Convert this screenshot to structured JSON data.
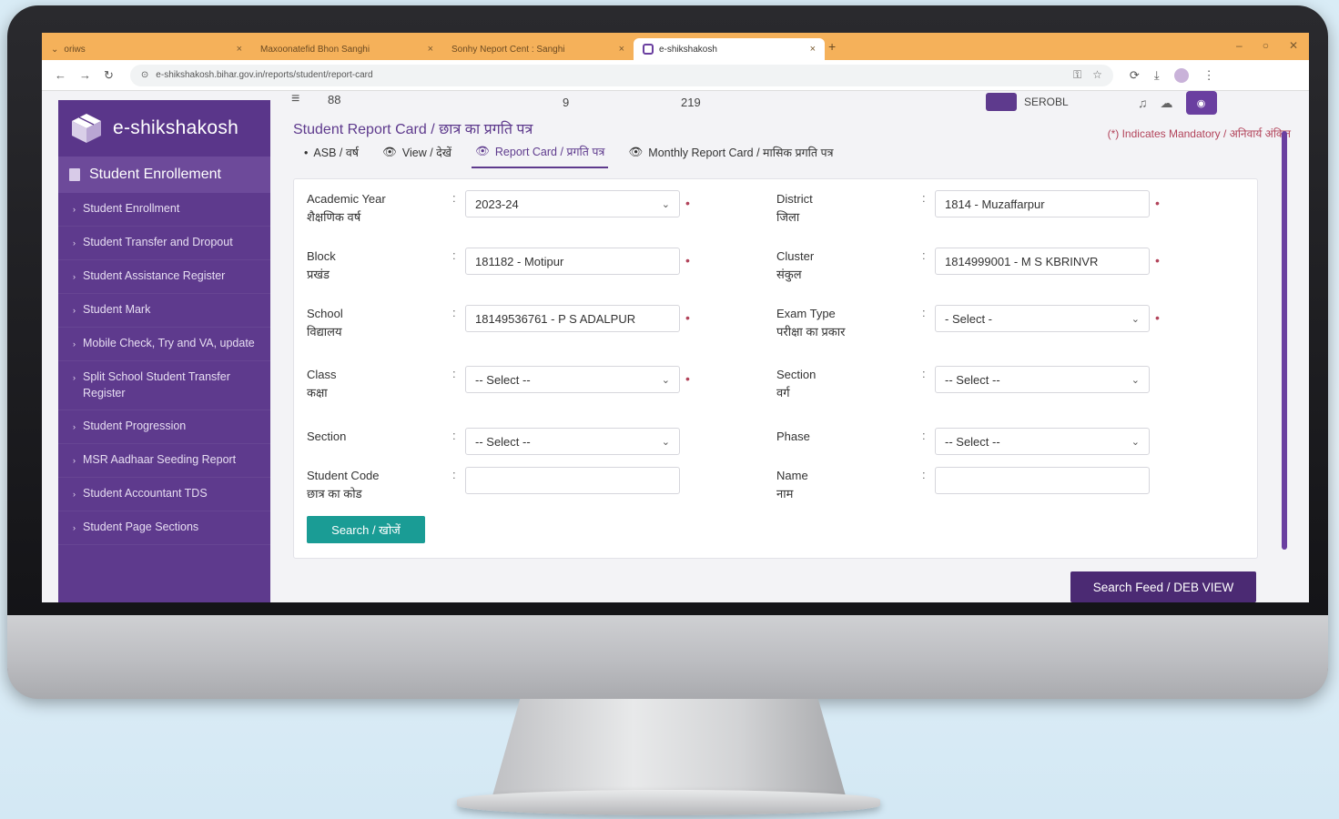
{
  "browser": {
    "tabs": [
      {
        "label": "oriws",
        "active": false
      },
      {
        "label": "Maxoonatefid Bhon Sanghi",
        "active": false
      },
      {
        "label": "Sonhy Neport Cent : Sanghi",
        "active": false
      },
      {
        "label": "e-shikshakosh",
        "active": true
      }
    ],
    "url": "e-shikshakosh.bihar.gov.in/reports/student/report-card"
  },
  "topbar": {
    "t1": "88",
    "t2": "9",
    "t3": "219",
    "user": "SEROBL"
  },
  "brand": {
    "name": "e-shikshakosh"
  },
  "sidebar": {
    "section": "Student Enrollement",
    "items": [
      "Student Enrollment",
      "Student Transfer and Dropout",
      "Student Assistance Register",
      "Student Mark",
      "Mobile Check, Try and VA, update",
      "Split School Student Transfer Register",
      "Student Progression",
      "MSR Aadhaar Seeding Report",
      "Student Accountant TDS",
      "Student Page Sections"
    ]
  },
  "page": {
    "title": "Student Report Card / छात्र का प्रगति पत्र",
    "mandatory_note": "(*) Indicates Mandatory / अनिवार्य अंकित",
    "tabs": [
      {
        "label": "ASB / वर्ष",
        "active": false
      },
      {
        "label": "View / देखें",
        "active": false
      },
      {
        "label": "Report Card / प्रगति पत्र",
        "active": true
      },
      {
        "label": "Monthly Report Card / मासिक प्रगति पत्र",
        "active": false
      }
    ],
    "fields": {
      "academic_year": {
        "label": "Academic Year",
        "label2": "शैक्षणिक वर्ष",
        "value": "2023-24"
      },
      "district": {
        "label": "District",
        "label2": "जिला",
        "value": "1814 - Muzaffarpur"
      },
      "block": {
        "label": "Block",
        "label2": "प्रखंड",
        "value": "181182 - Motipur"
      },
      "cluster": {
        "label": "Cluster",
        "label2": "संकुल",
        "value": "1814999001 - M S KBRINVR"
      },
      "school": {
        "label": "School",
        "label2": "विद्यालय",
        "value": "18149536761 - P S ADALPUR"
      },
      "exam_type": {
        "label": "Exam Type",
        "label2": "परीक्षा का प्रकार",
        "value": "- Select -"
      },
      "class": {
        "label": "Class",
        "label2": "कक्षा",
        "value": "-- Select --"
      },
      "section_right": {
        "label": "Section",
        "label2": "वर्ग",
        "value": "-- Select --"
      },
      "section": {
        "label": "Section",
        "label2": "",
        "value": "-- Select --"
      },
      "phase": {
        "label": "Phase",
        "label2": "",
        "value": "-- Select --"
      },
      "student_code": {
        "label": "Student Code",
        "label2": "छात्र का कोड",
        "value": ""
      },
      "name": {
        "label": "Name",
        "label2": "नाम",
        "value": ""
      }
    },
    "search_button": "Search / खोजें",
    "feed_button": "Search Feed / DEB VIEW"
  }
}
